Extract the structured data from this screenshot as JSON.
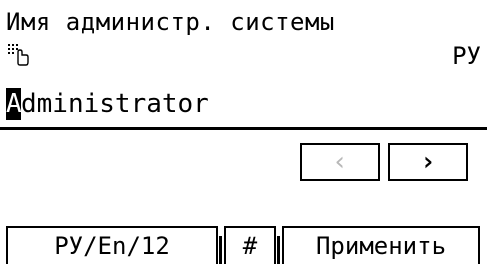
{
  "screen": {
    "title": "Имя администр. системы",
    "input_mode_indicator": "РУ",
    "keypad_icon": "keypad-touch-icon"
  },
  "input": {
    "cursor_char": "A",
    "rest_value": "dministrator"
  },
  "nav": {
    "left_arrow": "‹",
    "right_arrow": "›"
  },
  "softkeys": {
    "lang_label": "РУ/En/12",
    "symbol_label": "#",
    "apply_label": "Применить"
  }
}
